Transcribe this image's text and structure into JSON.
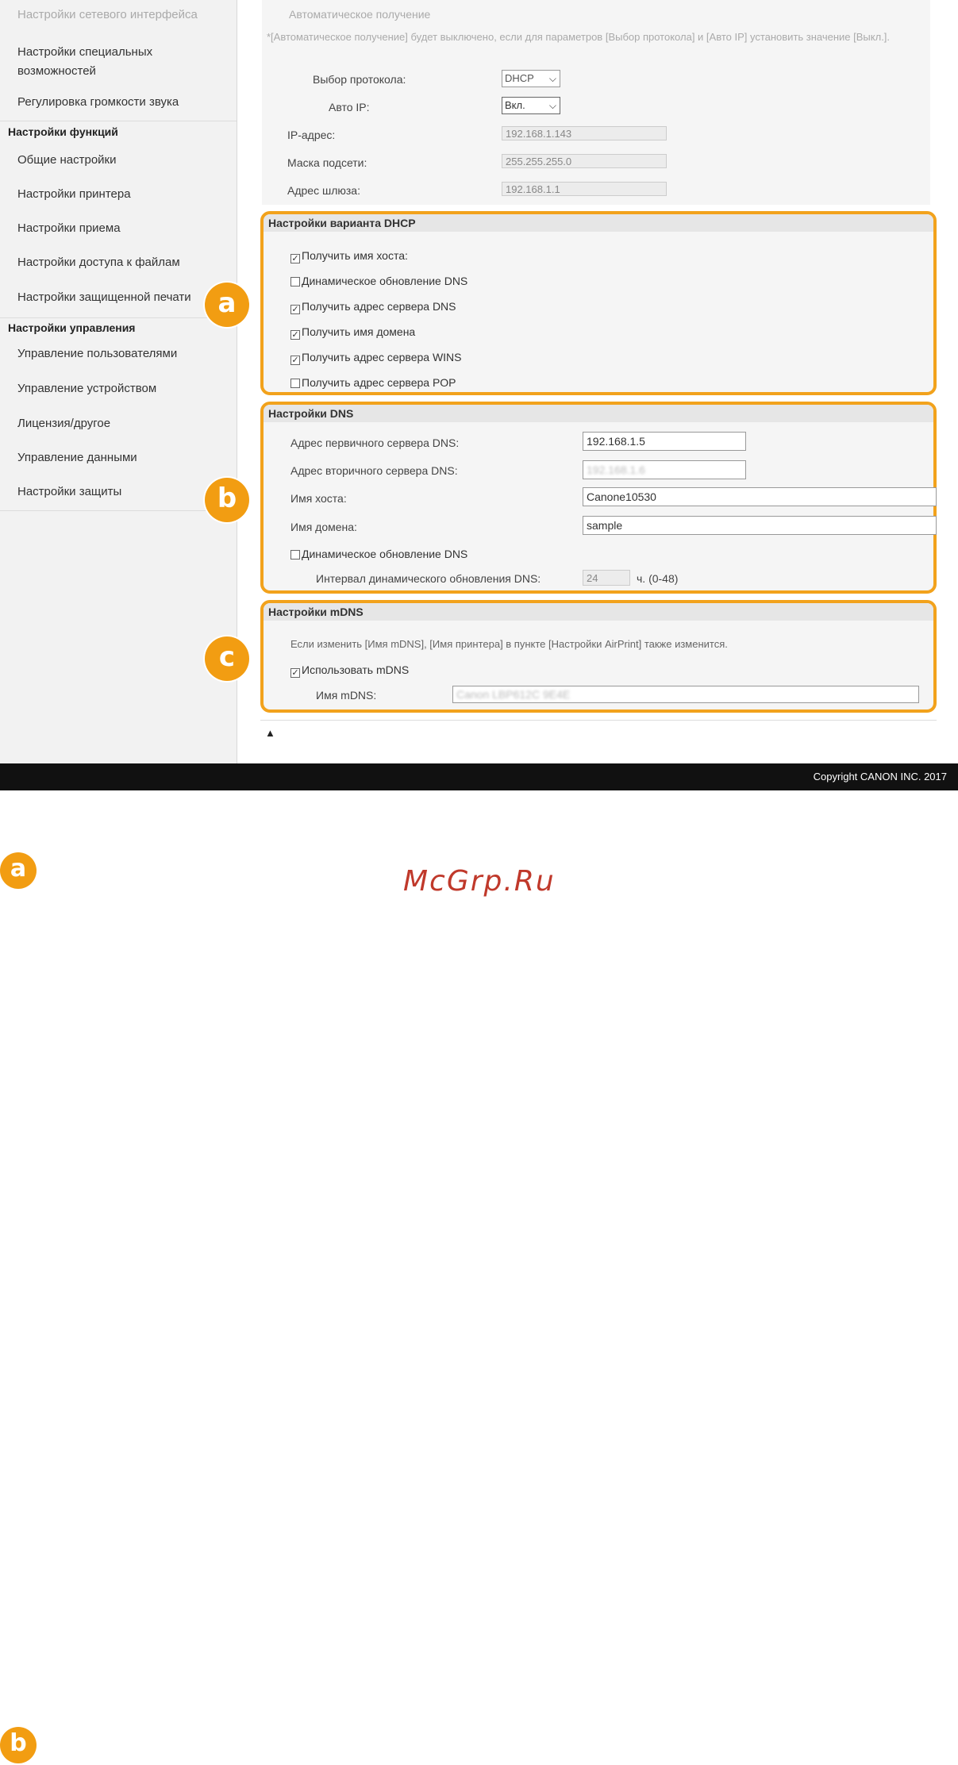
{
  "sidebar": {
    "items_top": [
      {
        "label": "Настройки сетевого интерфейса",
        "faded": true
      },
      {
        "label": "Настройки специальных возможностей",
        "faded": false
      },
      {
        "label": "Регулировка громкости звука",
        "faded": false
      }
    ],
    "functions_heading": "Настройки функций",
    "functions_items": [
      "Общие настройки",
      "Настройки принтера",
      "Настройки приема",
      "Настройки доступа к файлам",
      "Настройки защищенной печати"
    ],
    "management_heading": "Настройки управления",
    "management_items": [
      "Управление пользователями",
      "Управление устройством",
      "Лицензия/другое",
      "Управление данными",
      "Настройки защиты"
    ]
  },
  "top_section": {
    "faded_heading": "Автоматическое получение",
    "note": "*[Автоматическое получение] будет выключено, если для параметров [Выбор протокола] и [Авто IP] установить значение [Выкл.].",
    "protocol_label": "Выбор протокола:",
    "protocol_value": "DHCP",
    "auto_ip_label": "Авто IP:",
    "auto_ip_value": "Вкл.",
    "ip_label": "IP-адрес:",
    "ip_value": "192.168.1.143",
    "mask_label": "Маска подсети:",
    "mask_value": "255.255.255.0",
    "gateway_label": "Адрес шлюза:",
    "gateway_value": "192.168.1.1"
  },
  "dhcp_panel": {
    "title": "Настройки варианта DHCP",
    "options": [
      {
        "label": "Получить имя хоста",
        "checked": true
      },
      {
        "label": "Динамическое обновление DNS",
        "checked": false
      },
      {
        "label": "Получить адрес сервера DNS",
        "checked": true
      },
      {
        "label": "Получить имя домена",
        "checked": true
      },
      {
        "label": "Получить адрес сервера WINS",
        "checked": true
      },
      {
        "label": "Получить адрес сервера POP",
        "checked": false
      }
    ]
  },
  "dns_panel": {
    "title": "Настройки DNS",
    "primary_label": "Адрес первичного сервера DNS:",
    "primary_value": "192.168.1.5",
    "secondary_label": "Адрес вторичного сервера DNS:",
    "secondary_value": "192.168.1.6",
    "host_label": "Имя хоста:",
    "host_value": "Canone10530",
    "domain_label": "Имя домена:",
    "domain_value": "sample",
    "dynamic_update_label": "Динамическое обновление DNS",
    "dynamic_update_checked": false,
    "interval_label": "Интервал динамического обновления DNS:",
    "interval_value": "24",
    "interval_unit": "ч. (0-48)"
  },
  "mdns_panel": {
    "title": "Настройки mDNS",
    "note": "Если изменить [Имя mDNS], [Имя принтера] в пункте [Настройки AirPrint] также изменится.",
    "use_label": "Использовать mDNS",
    "use_checked": true,
    "name_label": "Имя mDNS:",
    "name_value": "Canon LBP612C 9E4E"
  },
  "badges": {
    "a": "a",
    "b": "b",
    "c": "c"
  },
  "scroll_top_glyph": "▲",
  "footer": {
    "copyright": "Copyright CANON INC. 2017"
  },
  "watermark": "McGrp.Ru",
  "doc_badges": {
    "a": "a",
    "b": "b"
  },
  "colors": {
    "accent": "#f2a21c",
    "footer_bg": "#111111",
    "watermark": "#c0392b"
  }
}
